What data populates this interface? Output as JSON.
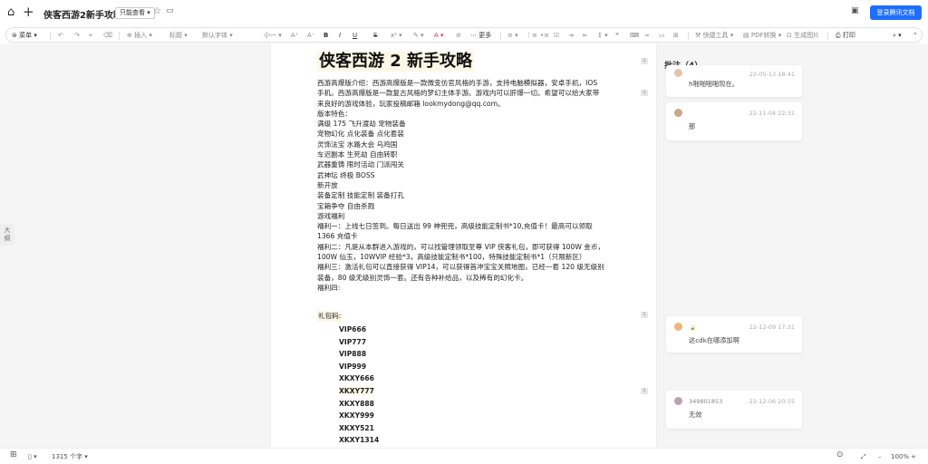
{
  "topbar": {
    "title": "侠客西游2新手攻略",
    "permission": "只能查看 ▾",
    "login_button": "登录腾讯文档"
  },
  "toolbar": {
    "menu": "菜单",
    "insert": "插入",
    "heading": "标题",
    "font": "默认字体",
    "font_size": "小一",
    "more": "更多",
    "quick_tools": "快捷工具",
    "pdf": "PDF转换",
    "gen_image": "生成图片",
    "print": "打印"
  },
  "side_tab": {
    "label_top": "大",
    "label_bottom": "纲"
  },
  "document": {
    "title": "侠客西游 2 新手攻略",
    "paragraphs": [
      "西游高爆版介绍：西游高爆版是一款微变仿官风格的手游，支持电脑模拟器，安卓手机，IOS",
      "手机。西游高爆版是一款复古风格的梦幻主体手游。游戏内可以肝爆一切。希望可以给大家带",
      "来良好的游戏体验，玩家投稿邮箱 lookmydong@qq.com。",
      "版本特色：",
      "满级 175 飞升渡劫 宠物装备",
      "宠物幻化 点化装备 点化套装",
      "灵饰法宝 水路大会 乌鸡国",
      "车迟副本 生死劫   自由转职",
      "武器重铸 限时活动 门派闯关",
      "武神坛   终极 BOSS",
      "新开放",
      "装备定制 技能定制 装备打孔",
      "宝箱争夺 自由杀戮",
      "游戏福利",
      "福利一：上线七日签到。每日送出 99 神兜兜，高级技能定制书*10,充值卡！最高可以领取",
      "1366 充值卡",
      "福利二：凡是从本群进入游戏的，可以找管理领取至尊 VIP 侠客礼包，即可获得 100W 金币，",
      "100W 仙玉，10WVIP 经验*3，高级技能定制书*100，特殊技能定制书*1（只限新区）",
      "福利三：激活礼包可以直接获得 VIP14，可以获得首冲宝宝关照地图，已经一套 120 级无级别",
      "装备，80 级无级别灵饰一套。还有各种补给品，以及稀有的幻化卡。",
      "福利四:"
    ],
    "gift_label": "礼包码:",
    "gift_codes": [
      "VIP666",
      "VIP777",
      "VIP888",
      "VIP999",
      "XKXY666",
      "XKXY777",
      "XKXY888",
      "XKXY999",
      "XKXY521",
      "XKXY1314"
    ]
  },
  "markers": [
    "1",
    "1",
    "1",
    "1"
  ],
  "comments": {
    "header": "批注（4）",
    "items": [
      {
        "user": "",
        "time": "22-05-13 18:41",
        "text": "h啪啪啪啪现在。"
      },
      {
        "user": "",
        "time": "22-11-04 22:31",
        "text": "那"
      },
      {
        "user": "",
        "time": "22-12-09 17:31",
        "text": "这cdk在哪添加啊"
      },
      {
        "user": "349801853",
        "time": "22-12-06 20:55",
        "text": "无效"
      }
    ]
  },
  "statusbar": {
    "word_count": "1315 个字 ▾",
    "zoom": "100%"
  },
  "colors": {
    "accent": "#1e6fff",
    "highlight": "#fdf7e6"
  }
}
